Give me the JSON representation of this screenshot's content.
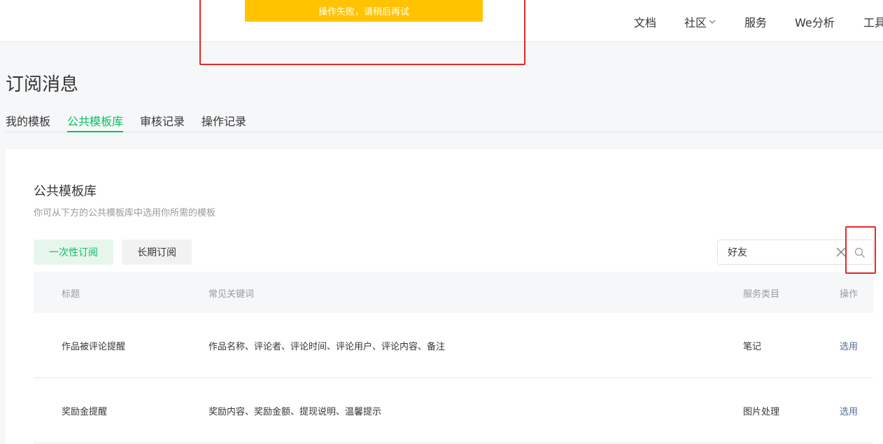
{
  "toast": {
    "message": "操作失败，请稍后再试"
  },
  "nav": {
    "items": [
      {
        "label": "文档"
      },
      {
        "label": "社区"
      },
      {
        "label": "服务"
      },
      {
        "label": "We分析"
      },
      {
        "label": "工具"
      }
    ]
  },
  "page": {
    "title": "订阅消息"
  },
  "tabs": [
    {
      "label": "我的模板"
    },
    {
      "label": "公共模板库"
    },
    {
      "label": "审核记录"
    },
    {
      "label": "操作记录"
    }
  ],
  "library": {
    "title": "公共模板库",
    "description": "你可从下方的公共模板库中选用你所需的模板",
    "type_buttons": [
      {
        "label": "一次性订阅"
      },
      {
        "label": "长期订阅"
      }
    ],
    "search": {
      "value": "好友"
    }
  },
  "table": {
    "headers": [
      "标题",
      "常见关键词",
      "服务类目",
      "操作"
    ],
    "rows": [
      {
        "title": "作品被评论提醒",
        "keywords": "作品名称、评论者、评论时间、评论用户、评论内容、备注",
        "category": "笔记",
        "action": "选用"
      },
      {
        "title": "奖励金提醒",
        "keywords": "奖励内容、奖励金额、提现说明、温馨提示",
        "category": "图片处理",
        "action": "选用"
      }
    ]
  },
  "colors": {
    "accent": "#07c160",
    "link": "#576b95",
    "toast": "#ffc300",
    "annotation": "#e52a2a"
  }
}
